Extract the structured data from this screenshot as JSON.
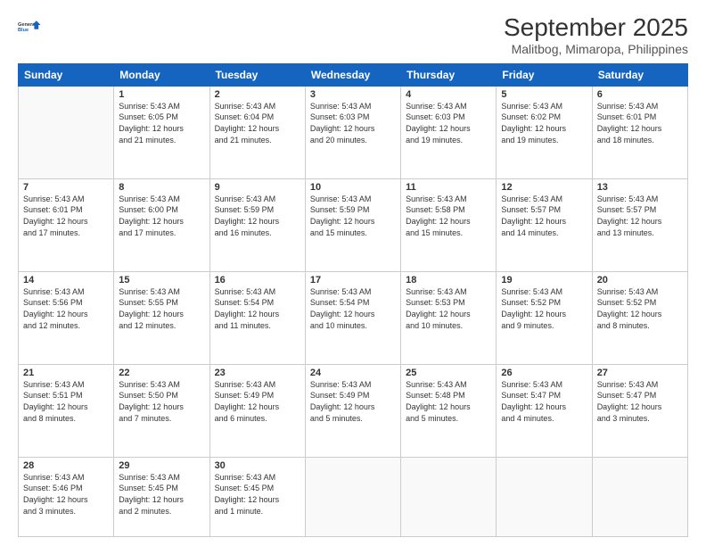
{
  "header": {
    "logo_line1": "General",
    "logo_line2": "Blue",
    "title": "September 2025",
    "subtitle": "Malitbog, Mimaropa, Philippines"
  },
  "columns": [
    "Sunday",
    "Monday",
    "Tuesday",
    "Wednesday",
    "Thursday",
    "Friday",
    "Saturday"
  ],
  "weeks": [
    [
      {
        "day": "",
        "info": ""
      },
      {
        "day": "1",
        "info": "Sunrise: 5:43 AM\nSunset: 6:05 PM\nDaylight: 12 hours\nand 21 minutes."
      },
      {
        "day": "2",
        "info": "Sunrise: 5:43 AM\nSunset: 6:04 PM\nDaylight: 12 hours\nand 21 minutes."
      },
      {
        "day": "3",
        "info": "Sunrise: 5:43 AM\nSunset: 6:03 PM\nDaylight: 12 hours\nand 20 minutes."
      },
      {
        "day": "4",
        "info": "Sunrise: 5:43 AM\nSunset: 6:03 PM\nDaylight: 12 hours\nand 19 minutes."
      },
      {
        "day": "5",
        "info": "Sunrise: 5:43 AM\nSunset: 6:02 PM\nDaylight: 12 hours\nand 19 minutes."
      },
      {
        "day": "6",
        "info": "Sunrise: 5:43 AM\nSunset: 6:01 PM\nDaylight: 12 hours\nand 18 minutes."
      }
    ],
    [
      {
        "day": "7",
        "info": "Sunrise: 5:43 AM\nSunset: 6:01 PM\nDaylight: 12 hours\nand 17 minutes."
      },
      {
        "day": "8",
        "info": "Sunrise: 5:43 AM\nSunset: 6:00 PM\nDaylight: 12 hours\nand 17 minutes."
      },
      {
        "day": "9",
        "info": "Sunrise: 5:43 AM\nSunset: 5:59 PM\nDaylight: 12 hours\nand 16 minutes."
      },
      {
        "day": "10",
        "info": "Sunrise: 5:43 AM\nSunset: 5:59 PM\nDaylight: 12 hours\nand 15 minutes."
      },
      {
        "day": "11",
        "info": "Sunrise: 5:43 AM\nSunset: 5:58 PM\nDaylight: 12 hours\nand 15 minutes."
      },
      {
        "day": "12",
        "info": "Sunrise: 5:43 AM\nSunset: 5:57 PM\nDaylight: 12 hours\nand 14 minutes."
      },
      {
        "day": "13",
        "info": "Sunrise: 5:43 AM\nSunset: 5:57 PM\nDaylight: 12 hours\nand 13 minutes."
      }
    ],
    [
      {
        "day": "14",
        "info": "Sunrise: 5:43 AM\nSunset: 5:56 PM\nDaylight: 12 hours\nand 12 minutes."
      },
      {
        "day": "15",
        "info": "Sunrise: 5:43 AM\nSunset: 5:55 PM\nDaylight: 12 hours\nand 12 minutes."
      },
      {
        "day": "16",
        "info": "Sunrise: 5:43 AM\nSunset: 5:54 PM\nDaylight: 12 hours\nand 11 minutes."
      },
      {
        "day": "17",
        "info": "Sunrise: 5:43 AM\nSunset: 5:54 PM\nDaylight: 12 hours\nand 10 minutes."
      },
      {
        "day": "18",
        "info": "Sunrise: 5:43 AM\nSunset: 5:53 PM\nDaylight: 12 hours\nand 10 minutes."
      },
      {
        "day": "19",
        "info": "Sunrise: 5:43 AM\nSunset: 5:52 PM\nDaylight: 12 hours\nand 9 minutes."
      },
      {
        "day": "20",
        "info": "Sunrise: 5:43 AM\nSunset: 5:52 PM\nDaylight: 12 hours\nand 8 minutes."
      }
    ],
    [
      {
        "day": "21",
        "info": "Sunrise: 5:43 AM\nSunset: 5:51 PM\nDaylight: 12 hours\nand 8 minutes."
      },
      {
        "day": "22",
        "info": "Sunrise: 5:43 AM\nSunset: 5:50 PM\nDaylight: 12 hours\nand 7 minutes."
      },
      {
        "day": "23",
        "info": "Sunrise: 5:43 AM\nSunset: 5:49 PM\nDaylight: 12 hours\nand 6 minutes."
      },
      {
        "day": "24",
        "info": "Sunrise: 5:43 AM\nSunset: 5:49 PM\nDaylight: 12 hours\nand 5 minutes."
      },
      {
        "day": "25",
        "info": "Sunrise: 5:43 AM\nSunset: 5:48 PM\nDaylight: 12 hours\nand 5 minutes."
      },
      {
        "day": "26",
        "info": "Sunrise: 5:43 AM\nSunset: 5:47 PM\nDaylight: 12 hours\nand 4 minutes."
      },
      {
        "day": "27",
        "info": "Sunrise: 5:43 AM\nSunset: 5:47 PM\nDaylight: 12 hours\nand 3 minutes."
      }
    ],
    [
      {
        "day": "28",
        "info": "Sunrise: 5:43 AM\nSunset: 5:46 PM\nDaylight: 12 hours\nand 3 minutes."
      },
      {
        "day": "29",
        "info": "Sunrise: 5:43 AM\nSunset: 5:45 PM\nDaylight: 12 hours\nand 2 minutes."
      },
      {
        "day": "30",
        "info": "Sunrise: 5:43 AM\nSunset: 5:45 PM\nDaylight: 12 hours\nand 1 minute."
      },
      {
        "day": "",
        "info": ""
      },
      {
        "day": "",
        "info": ""
      },
      {
        "day": "",
        "info": ""
      },
      {
        "day": "",
        "info": ""
      }
    ]
  ]
}
